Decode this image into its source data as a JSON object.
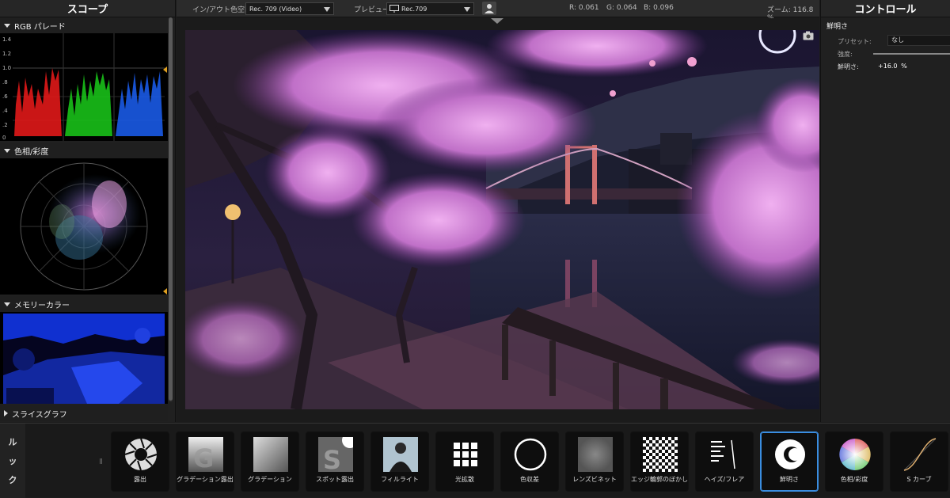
{
  "left_panel": {
    "title": "スコープ",
    "sections": [
      {
        "label": "RGB パレード",
        "expanded": true
      },
      {
        "label": "色相/彩度",
        "expanded": true
      },
      {
        "label": "メモリーカラー",
        "expanded": true
      },
      {
        "label": "スライスグラフ",
        "expanded": false
      }
    ],
    "parade_ticks": [
      "1.4",
      "1.2",
      "1.0",
      ".8",
      ".6",
      ".4",
      ".2",
      "0"
    ]
  },
  "toolbar": {
    "colorspace_label": "イン/アウト色空間:",
    "colorspace_value": "Rec. 709 (Video)",
    "preview_label": "プレビュー:",
    "preview_value": "Rec.709",
    "r_readout": "R: 0.061",
    "g_readout": "G: 0.064",
    "b_readout": "B: 0.096",
    "zoom_readout": "ズーム: 116.8 %"
  },
  "right_panel": {
    "title": "コントロール",
    "section": "鮮明さ",
    "preset_label": "プリセット:",
    "preset_value": "なし",
    "intensity_label": "強度:",
    "clarity_label": "鮮明さ:",
    "clarity_value": "+16.0",
    "clarity_unit": "%"
  },
  "looks": {
    "side_label_1": "ル",
    "side_label_2": "ッ",
    "side_label_3": "ク",
    "tiles": [
      {
        "label": "露出"
      },
      {
        "label": "グラデーション露出"
      },
      {
        "label": "グラデーション"
      },
      {
        "label": "スポット露出"
      },
      {
        "label": "フィルライト"
      },
      {
        "label": "光拡散"
      },
      {
        "label": "色収差"
      },
      {
        "label": "レンズビネット"
      },
      {
        "label": "エッジ輪郭のぼかし"
      },
      {
        "label": "ヘイズ/フレア"
      },
      {
        "label": "鮮明さ",
        "selected": true
      },
      {
        "label": "色相/彩度"
      },
      {
        "label": "S カーブ"
      }
    ]
  },
  "icons": {
    "monitor": "monitor-icon",
    "person": "person-icon",
    "camera": "camera-icon"
  }
}
